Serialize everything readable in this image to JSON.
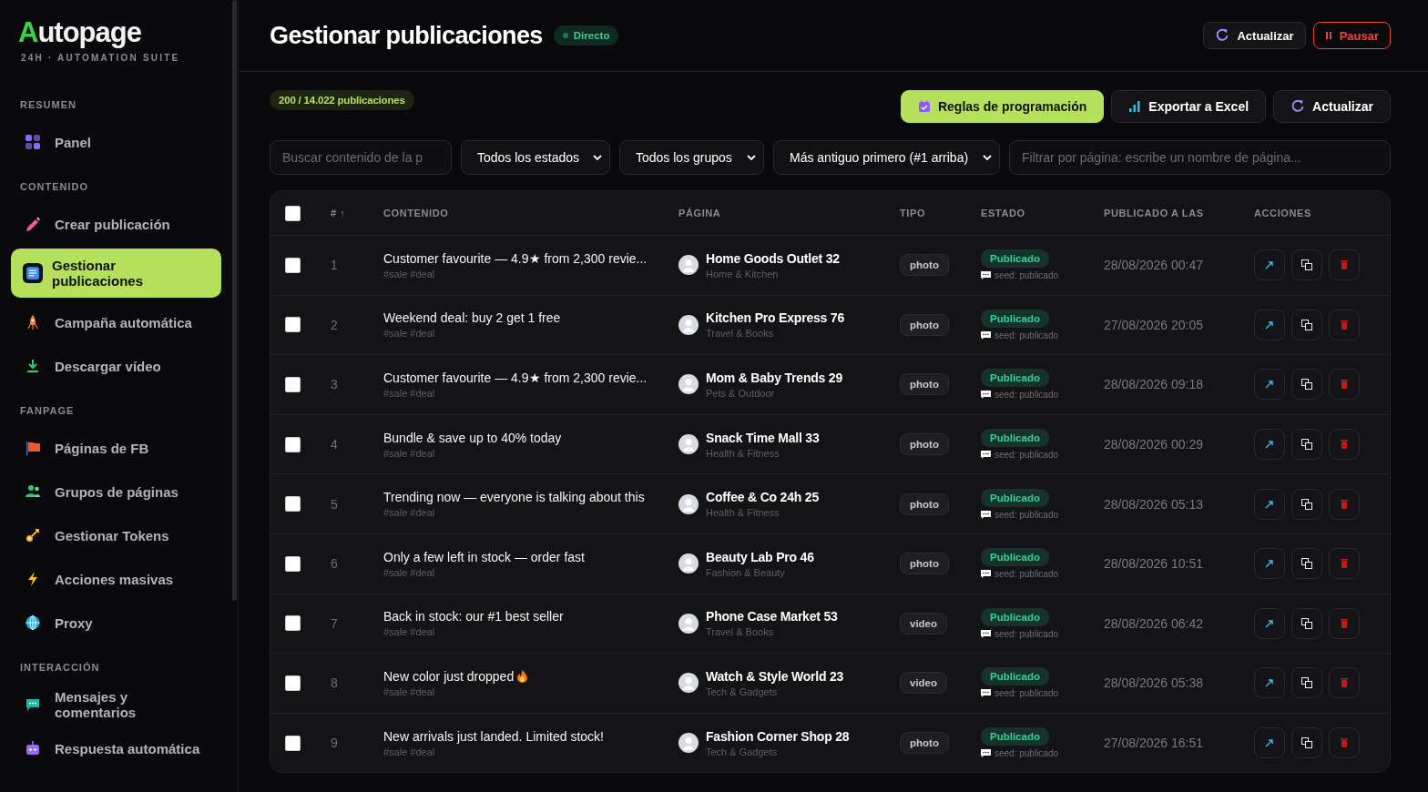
{
  "brand": {
    "logo": "Autopage",
    "tagline": "24H · AUTOMATION SUITE"
  },
  "sidebar": {
    "sections": [
      {
        "label": "RESUMEN",
        "items": [
          {
            "label": "Panel",
            "selected": false
          }
        ]
      },
      {
        "label": "CONTENIDO",
        "items": [
          {
            "label": "Crear publicación",
            "selected": false
          },
          {
            "label": "Gestionar publicaciones",
            "selected": true
          },
          {
            "label": "Campaña automática",
            "selected": false
          },
          {
            "label": "Descargar vídeo",
            "selected": false
          }
        ]
      },
      {
        "label": "FANPAGE",
        "items": [
          {
            "label": "Páginas de FB",
            "selected": false
          },
          {
            "label": "Grupos de páginas",
            "selected": false
          },
          {
            "label": "Gestionar Tokens",
            "selected": false
          },
          {
            "label": "Acciones masivas",
            "selected": false
          },
          {
            "label": "Proxy",
            "selected": false
          }
        ]
      },
      {
        "label": "INTERACCIÓN",
        "items": [
          {
            "label": "Mensajes y comentarios",
            "selected": false
          },
          {
            "label": "Respuesta automática",
            "selected": false
          }
        ]
      }
    ]
  },
  "header": {
    "title": "Gestionar publicaciones",
    "live_badge": "Directo",
    "buttons": [
      {
        "label": "Actualizar",
        "kind": "plain"
      },
      {
        "label": "Pausar",
        "kind": "danger"
      }
    ]
  },
  "toolbar": {
    "count": "200 / 14.022 publicaciones",
    "buttons": [
      {
        "label": "Reglas de programación",
        "kind": "primary"
      },
      {
        "label": "Exportar a Excel",
        "kind": "plain"
      },
      {
        "label": "Actualizar",
        "kind": "plain"
      }
    ]
  },
  "filters": {
    "search": {
      "placeholder": "Buscar contenido de la p"
    },
    "selects": [
      "Todos los estados",
      "Todos los grupos",
      "Más antiguo primero (#1 arriba)"
    ],
    "page_filter": {
      "placeholder": "Filtrar por página: escribe un nombre de página..."
    }
  },
  "table": {
    "select_all": {
      "checked": false
    },
    "columns": [
      "# ↑",
      "CONTENIDO",
      "PÁGINA",
      "TIPO",
      "ESTADO",
      "PUBLICADO A LAS",
      "ACCIONES"
    ],
    "rows": [
      {
        "checked": false,
        "number": "1",
        "content": "Customer favourite — 4.9★ from 2,300 revie...",
        "hot": false,
        "tags": "#sale #deal",
        "page": "Home Goods Outlet 32",
        "category": "Home & Kitchen",
        "type": "photo",
        "status": "Publicado",
        "note": "seed: publicado",
        "published_at": "28/08/2026 00:47"
      },
      {
        "checked": false,
        "number": "2",
        "content": "Weekend deal: buy 2 get 1 free",
        "hot": false,
        "tags": "#sale #deal",
        "page": "Kitchen Pro Express 76",
        "category": "Travel & Books",
        "type": "photo",
        "status": "Publicado",
        "note": "seed: publicado",
        "published_at": "27/08/2026 20:05"
      },
      {
        "checked": false,
        "number": "3",
        "content": "Customer favourite — 4.9★ from 2,300 revie...",
        "hot": false,
        "tags": "#sale #deal",
        "page": "Mom & Baby Trends 29",
        "category": "Pets & Outdoor",
        "type": "photo",
        "status": "Publicado",
        "note": "seed: publicado",
        "published_at": "28/08/2026 09:18"
      },
      {
        "checked": false,
        "number": "4",
        "content": "Bundle & save up to 40% today",
        "hot": false,
        "tags": "#sale #deal",
        "page": "Snack Time Mall 33",
        "category": "Health & Fitness",
        "type": "photo",
        "status": "Publicado",
        "note": "seed: publicado",
        "published_at": "28/08/2026 00:29"
      },
      {
        "checked": false,
        "number": "5",
        "content": "Trending now — everyone is talking about this",
        "hot": false,
        "tags": "#sale #deal",
        "page": "Coffee & Co 24h 25",
        "category": "Health & Fitness",
        "type": "photo",
        "status": "Publicado",
        "note": "seed: publicado",
        "published_at": "28/08/2026 05:13"
      },
      {
        "checked": false,
        "number": "6",
        "content": "Only a few left in stock — order fast",
        "hot": false,
        "tags": "#sale #deal",
        "page": "Beauty Lab Pro 46",
        "category": "Fashion & Beauty",
        "type": "photo",
        "status": "Publicado",
        "note": "seed: publicado",
        "published_at": "28/08/2026 10:51"
      },
      {
        "checked": false,
        "number": "7",
        "content": "Back in stock: our #1 best seller",
        "hot": false,
        "tags": "#sale #deal",
        "page": "Phone Case Market 53",
        "category": "Travel & Books",
        "type": "video",
        "status": "Publicado",
        "note": "seed: publicado",
        "published_at": "28/08/2026 06:42"
      },
      {
        "checked": false,
        "number": "8",
        "content": "New color just dropped",
        "hot": true,
        "tags": "#sale #deal",
        "page": "Watch & Style World 23",
        "category": "Tech & Gadgets",
        "type": "video",
        "status": "Publicado",
        "note": "seed: publicado",
        "published_at": "28/08/2026 05:38"
      },
      {
        "checked": false,
        "number": "9",
        "content": "New arrivals just landed. Limited stock!",
        "hot": false,
        "tags": "#sale #deal",
        "page": "Fashion Corner Shop 28",
        "category": "Tech & Gadgets",
        "type": "photo",
        "status": "Publicado",
        "note": "seed: publicado",
        "published_at": "27/08/2026 16:51"
      }
    ]
  }
}
